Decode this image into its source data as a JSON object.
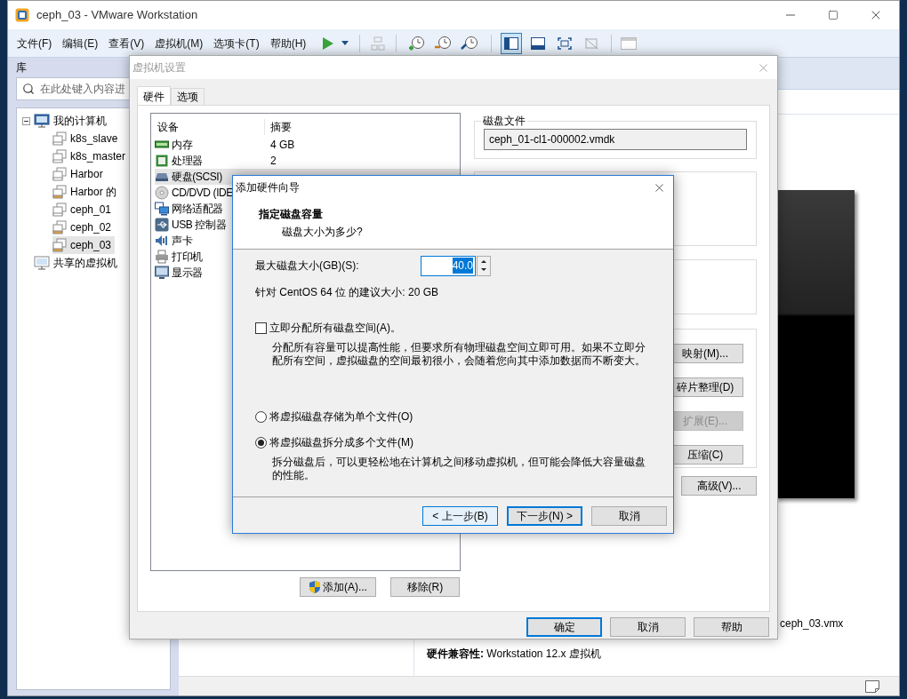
{
  "main_window": {
    "title": "ceph_03 - VMware Workstation",
    "menu": [
      "文件(F)",
      "编辑(E)",
      "查看(V)",
      "虚拟机(M)",
      "选项卡(T)",
      "帮助(H)"
    ],
    "view_modes": [
      {
        "selected": true
      },
      {
        "selected": false
      },
      {
        "selected": false
      },
      {
        "selected": false
      }
    ],
    "library": {
      "title": "库",
      "search": {
        "placeholder": "在此处键入内容进"
      },
      "tree": [
        {
          "label": "我的计算机",
          "expanded": true,
          "selected": false,
          "children": [
            {
              "label": "k8s_slave",
              "running": false,
              "selected": false
            },
            {
              "label": "k8s_master",
              "running": false,
              "selected": false
            },
            {
              "label": "Harbor",
              "running": false,
              "selected": false
            },
            {
              "label": "Harbor 的",
              "running": true,
              "selected": false
            },
            {
              "label": "ceph_01",
              "running": false,
              "selected": false
            },
            {
              "label": "ceph_02",
              "running": true,
              "selected": false
            },
            {
              "label": "ceph_03",
              "running": true,
              "selected": true
            }
          ]
        },
        {
          "label": "共享的虚拟机",
          "selected": false
        }
      ]
    },
    "details": {
      "config_file": "ceph_03.vmx",
      "compat_label": "硬件兼容性:",
      "compat_value": "Workstation 12.x 虚拟机"
    }
  },
  "settings_dialog": {
    "title": "虚拟机设置",
    "tabs": [
      {
        "label": "硬件",
        "selected": true
      },
      {
        "label": "选项",
        "selected": false
      }
    ],
    "device_table": {
      "columns": [
        "设备",
        "摘要"
      ],
      "rows": [
        {
          "kind": "memory",
          "device": "内存",
          "summary": "4 GB",
          "selected": false
        },
        {
          "kind": "cpu",
          "device": "处理器",
          "summary": "2",
          "selected": false
        },
        {
          "kind": "disk",
          "device": "硬盘(SCSI)",
          "selected": true
        },
        {
          "kind": "cdrom",
          "device": "CD/DVD (IDE",
          "selected": false
        },
        {
          "kind": "network",
          "device": "网络适配器",
          "selected": false
        },
        {
          "kind": "usb",
          "device": "USB 控制器",
          "selected": false
        },
        {
          "kind": "sound",
          "device": "声卡",
          "selected": false
        },
        {
          "kind": "printer",
          "device": "打印机",
          "selected": false
        },
        {
          "kind": "display",
          "device": "显示器",
          "selected": false
        }
      ]
    },
    "add_button": "添加(A)...",
    "remove_button": "移除(R)",
    "disk_file": {
      "label": "磁盘文件",
      "value": "ceph_01-cl1-000002.vmdk"
    },
    "utility_buttons": [
      {
        "label": "映射(M)...",
        "disabled": false
      },
      {
        "label": "碎片整理(D)",
        "disabled": false
      },
      {
        "label": "扩展(E)...",
        "disabled": true
      },
      {
        "label": "压缩(C)",
        "disabled": false
      }
    ],
    "advanced_button": "高级(V)...",
    "buttons": [
      {
        "label": "确定",
        "default": true
      },
      {
        "label": "取消",
        "default": false
      },
      {
        "label": "帮助",
        "default": false
      }
    ]
  },
  "wizard": {
    "title": "添加硬件向导",
    "heading": "指定磁盘容量",
    "subheading": "磁盘大小为多少?",
    "size_label": "最大磁盘大小(GB)(S):",
    "size_value": "40.0",
    "recommendation": "针对 CentOS 64 位 的建议大小: 20 GB",
    "allocate": {
      "label": "立即分配所有磁盘空间(A)。",
      "checked": false,
      "description": "分配所有容量可以提高性能，但要求所有物理磁盘空间立即可用。如果不立即分配所有空间，虚拟磁盘的空间最初很小，会随着您向其中添加数据而不断变大。"
    },
    "storage_options": [
      {
        "label": "将虚拟磁盘存储为单个文件(O)",
        "selected": false
      },
      {
        "label": "将虚拟磁盘拆分成多个文件(M)",
        "selected": true,
        "description": "拆分磁盘后，可以更轻松地在计算机之间移动虚拟机，但可能会降低大容量磁盘的性能。"
      }
    ],
    "buttons": [
      {
        "label": "< 上一步(B)",
        "kind": "back"
      },
      {
        "label": "下一步(N) >",
        "kind": "default"
      },
      {
        "label": "取消",
        "kind": "normal"
      }
    ]
  }
}
